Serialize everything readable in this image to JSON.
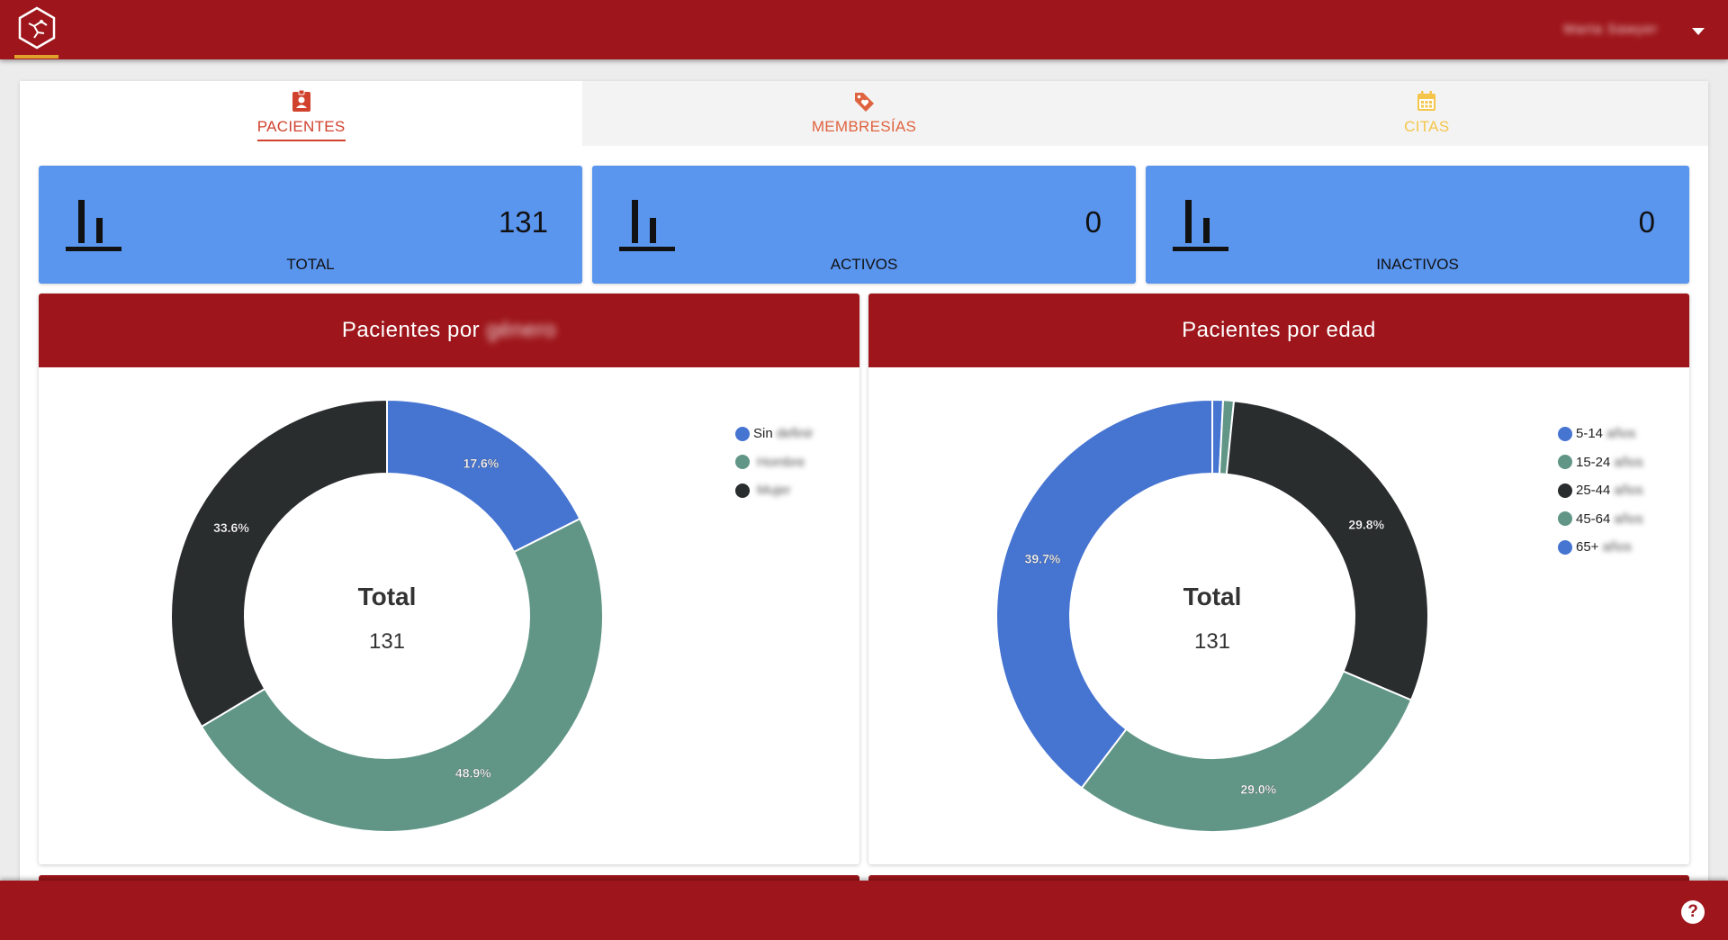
{
  "colors": {
    "brand_red": "#9e161b",
    "stat_blue": "#5a95ee",
    "tab_active": "#d0422e",
    "tab_membresias": "#e0633f",
    "tab_citas": "#f4c54a",
    "series_blue": "#4674d1",
    "series_green": "#619686",
    "series_dark": "#2a2d2e"
  },
  "header": {
    "user_name": "Marta Sawyer",
    "user_menu_icon": "caret-down-icon",
    "logo_icon": "hexagon-logo-icon"
  },
  "tabs": [
    {
      "label": "PACIENTES",
      "icon": "patient-badge-icon",
      "active": true
    },
    {
      "label": "MEMBRESÍAS",
      "icon": "tag-heart-icon",
      "active": false
    },
    {
      "label": "CITAS",
      "icon": "calendar-icon",
      "active": false
    }
  ],
  "stats": [
    {
      "label": "TOTAL",
      "value": "131",
      "icon": "bar-chart-icon"
    },
    {
      "label": "ACTIVOS",
      "value": "0",
      "icon": "bar-chart-icon"
    },
    {
      "label": "INACTIVOS",
      "value": "0",
      "icon": "bar-chart-icon"
    }
  ],
  "panels": {
    "gender": {
      "title": "Pacientes por",
      "title_blurred": "género",
      "center_label": "Total",
      "center_value": "131",
      "legend": [
        {
          "label": "Sin",
          "extra": "definir"
        },
        {
          "label": "",
          "extra": "Hombre"
        },
        {
          "label": "",
          "extra": "Mujer"
        }
      ]
    },
    "age": {
      "title": "Pacientes por edad",
      "center_label": "Total",
      "center_value": "131",
      "legend": [
        {
          "label": "5-14",
          "extra": "años"
        },
        {
          "label": "15-24",
          "extra": "años"
        },
        {
          "label": "25-44",
          "extra": "años"
        },
        {
          "label": "45-64",
          "extra": "años"
        },
        {
          "label": "65+",
          "extra": "años"
        }
      ]
    }
  },
  "chart_data": [
    {
      "type": "pie",
      "title": "Pacientes por género",
      "labels": [
        "Sin definir",
        "Hombre",
        "Mujer"
      ],
      "values": [
        17.6,
        48.9,
        33.6
      ],
      "value_labels": [
        "17.6%",
        "48.9%",
        "33.6%"
      ],
      "colors": [
        "#4674d1",
        "#619686",
        "#2a2d2e"
      ],
      "legend": "top-right",
      "total": 131
    },
    {
      "type": "pie",
      "title": "Pacientes por edad",
      "labels": [
        "5-14 años",
        "15-24 años",
        "25-44 años",
        "45-64 años",
        "65+ años"
      ],
      "values": [
        0.8,
        0.8,
        29.8,
        29.0,
        39.7
      ],
      "value_labels": [
        "",
        "",
        "29.8%",
        "29.0%",
        "39.7%"
      ],
      "colors": [
        "#4674d1",
        "#619686",
        "#2a2d2e",
        "#619686",
        "#4674d1"
      ],
      "legend": "top-right",
      "total": 131
    }
  ],
  "footer": {
    "help_label": "?",
    "help_icon": "help-circle-icon"
  }
}
